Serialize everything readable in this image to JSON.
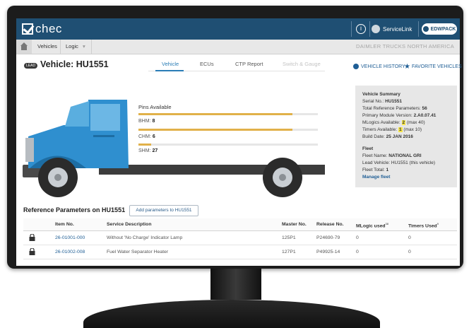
{
  "app": {
    "logo_text": "chec",
    "info_icon": "info-icon",
    "servicelink_label": "ServiceLink",
    "user_label": "EDWPACK"
  },
  "nav": {
    "home_icon": "home-icon",
    "vehicles_label": "Vehicles",
    "logic_label": "Logic",
    "brand": "DAIMLER TRUCKS NORTH AMERICA"
  },
  "vehicle": {
    "lead_badge": "LEAD",
    "title": "Vehicle: HU1551",
    "favorite_star": "☆"
  },
  "tabs": [
    {
      "label": "Vehicle",
      "active": true
    },
    {
      "label": "ECUs",
      "active": false
    },
    {
      "label": "CTP Report",
      "active": false
    },
    {
      "label": "Switch & Gauge",
      "active": false,
      "disabled": true
    }
  ],
  "links": {
    "history": "VEHICLE HISTORY",
    "favorites": "FAVORITE VEHICLES"
  },
  "pins": {
    "title": "Pins Available",
    "items": [
      {
        "label": "BHM:",
        "value": "8",
        "fill_fraction": 0.86
      },
      {
        "label": "CHM:",
        "value": "6",
        "fill_fraction": 0.86
      },
      {
        "label": "SHM:",
        "value": "27",
        "fill_fraction": 0.07
      }
    ]
  },
  "summary": {
    "heading": "Vehicle Summary",
    "serial_label": "Serial No.:",
    "serial_value": "HU1551",
    "total_params_label": "Total Reference Parameters:",
    "total_params_value": "56",
    "module_version_label": "Primary Module Version:",
    "module_version_value": "2.A0.07.41",
    "mlogics_label": "MLogics Available:",
    "mlogics_value": "2",
    "mlogics_max": "(max 40)",
    "timers_label": "Timers Available:",
    "timers_value": "1",
    "timers_max": "(max 10)",
    "build_date_label": "Build Date:",
    "build_date_value": "25 JAN 2016",
    "fleet_heading": "Fleet",
    "fleet_name_label": "Fleet Name:",
    "fleet_name_value": "NATIONAL GRI",
    "lead_vehicle_label": "Lead Vehicle:",
    "lead_vehicle_value": "HU1551 (this vehicle)",
    "fleet_total_label": "Fleet Total:",
    "fleet_total_value": "1",
    "manage_fleet": "Manage fleet"
  },
  "reference": {
    "title": "Reference Parameters on HU1551",
    "add_button": "Add parameters to HU1551",
    "columns": {
      "item_no": "Item No.",
      "description": "Service Description",
      "master_no": "Master No.",
      "release_no": "Release No.",
      "mlogic_used": "MLogic used",
      "mlogic_sup": "38",
      "timers_used": "Timers Used",
      "timers_sup": "9"
    },
    "rows": [
      {
        "item_no": "26-01001-000",
        "description": "Without 'No Charge' Indicator Lamp",
        "master_no": "125P1",
        "release_no": "P24690-79",
        "mlogic": "0",
        "timers": "0"
      },
      {
        "item_no": "26-01002-008",
        "description": "Fuel Water Separator Heater",
        "master_no": "127P1",
        "release_no": "P49925-14",
        "mlogic": "0",
        "timers": "0"
      }
    ]
  },
  "colors": {
    "topbar": "#1f4f73",
    "truck_blue": "#2f8fcf",
    "pin_bar": "#e1b14a",
    "highlight": "#f6e54a",
    "link": "#1f5e95"
  }
}
